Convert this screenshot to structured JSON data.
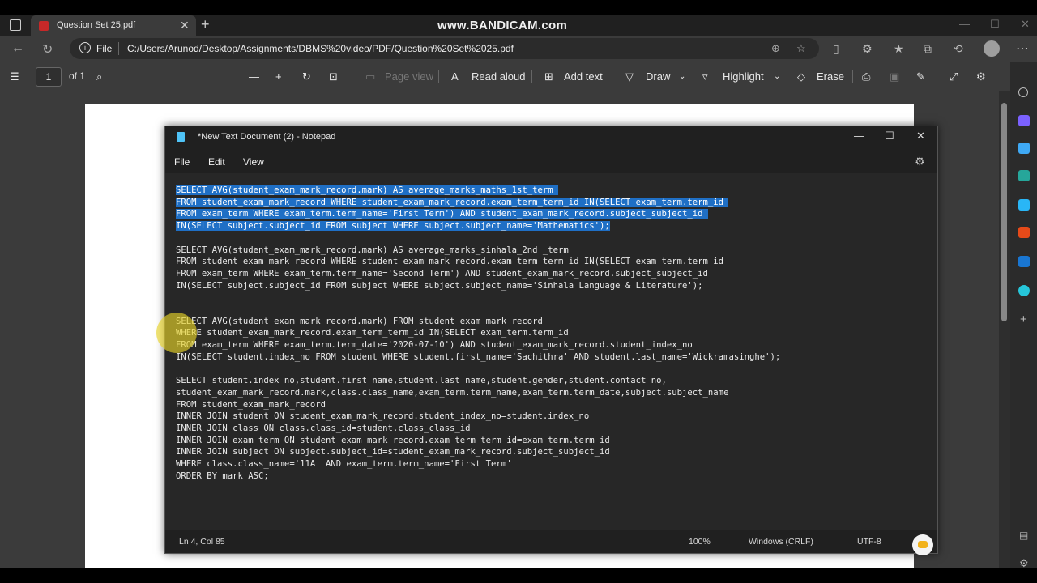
{
  "browser": {
    "tab_title": "Question Set 25.pdf",
    "tab_close": "✕",
    "new_tab": "+",
    "watermark": "www.BANDICAM.com",
    "file_label": "File",
    "url": "C:/Users/Arunod/Desktop/Assignments/DBMS%20video/PDF/Question%20Set%2025.pdf"
  },
  "pdf_toolbar": {
    "page_number": "1",
    "page_of": "of 1",
    "page_view": "Page view",
    "read_aloud": "Read aloud",
    "add_text": "Add text",
    "draw": "Draw",
    "highlight": "Highlight",
    "erase": "Erase"
  },
  "notepad": {
    "title": "*New Text Document (2) - Notepad",
    "menu": {
      "file": "File",
      "edit": "Edit",
      "view": "View"
    },
    "selected_query": [
      "SELECT AVG(student_exam_mark_record.mark) AS average_marks_maths_1st_term ",
      "FROM student_exam_mark_record WHERE student_exam_mark_record.exam_term_term_id IN(SELECT exam_term.term_id ",
      "FROM exam_term WHERE exam_term.term_name='First Term') AND student_exam_mark_record.subject_subject_id ",
      "IN(SELECT subject.subject_id FROM subject WHERE subject.subject_name='Mathematics');"
    ],
    "rest_of_text": "\n\nSELECT AVG(student_exam_mark_record.mark) AS average_marks_sinhala_2nd _term\nFROM student_exam_mark_record WHERE student_exam_mark_record.exam_term_term_id IN(SELECT exam_term.term_id\nFROM exam_term WHERE exam_term.term_name='Second Term') AND student_exam_mark_record.subject_subject_id\nIN(SELECT subject.subject_id FROM subject WHERE subject.subject_name='Sinhala Language & Literature');\n\n\nSELECT AVG(student_exam_mark_record.mark) FROM student_exam_mark_record\nWHERE student_exam_mark_record.exam_term_term_id IN(SELECT exam_term.term_id\nFROM exam_term WHERE exam_term.term_date='2020-07-10') AND student_exam_mark_record.student_index_no\nIN(SELECT student.index_no FROM student WHERE student.first_name='Sachithra' AND student.last_name='Wickramasinghe');\n\nSELECT student.index_no,student.first_name,student.last_name,student.gender,student.contact_no,\nstudent_exam_mark_record.mark,class.class_name,exam_term.term_name,exam_term.term_date,subject.subject_name\nFROM student_exam_mark_record\nINNER JOIN student ON student_exam_mark_record.student_index_no=student.index_no\nINNER JOIN class ON class.class_id=student.class_class_id\nINNER JOIN exam_term ON student_exam_mark_record.exam_term_term_id=exam_term.term_id\nINNER JOIN subject ON subject.subject_id=student_exam_mark_record.subject_subject_id\nWHERE class.class_name='11A' AND exam_term.term_name='First Term'\nORDER BY mark ASC;",
    "status": {
      "position": "Ln 4, Col 85",
      "zoom": "100%",
      "line_ending": "Windows (CRLF)",
      "encoding": "UTF-8"
    }
  },
  "colors": {
    "selection": "#1f6fc5",
    "notepad_bg": "#272727",
    "cursor_highlight": "#e6d228"
  }
}
